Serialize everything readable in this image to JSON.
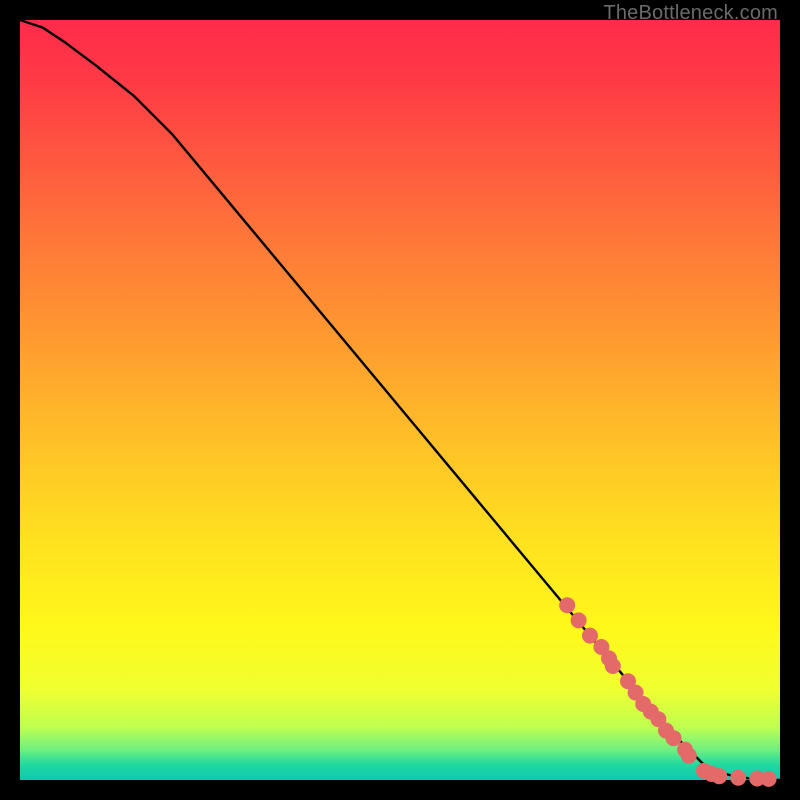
{
  "watermark": "TheBottleneck.com",
  "chart_data": {
    "type": "line",
    "title": "",
    "xlabel": "",
    "ylabel": "",
    "xlim": [
      0,
      100
    ],
    "ylim": [
      0,
      100
    ],
    "curve": {
      "name": "bottleneck-curve",
      "x": [
        0,
        3,
        6,
        10,
        15,
        20,
        30,
        40,
        50,
        60,
        70,
        80,
        85,
        88,
        90,
        92,
        94,
        96,
        98,
        100
      ],
      "y": [
        100,
        99,
        97,
        94,
        90,
        85,
        73,
        61,
        49,
        37,
        25,
        13,
        7,
        4,
        2,
        1,
        0.5,
        0.2,
        0,
        0
      ]
    },
    "highlight_points": {
      "name": "bottleneck-points",
      "color": "#e46a6a",
      "x": [
        72,
        73.5,
        75,
        76.5,
        77.5,
        78,
        80,
        81,
        82,
        83,
        84,
        85,
        86,
        87.5,
        88,
        90,
        91,
        92,
        94.5,
        97,
        98.5
      ],
      "y": [
        23,
        21,
        19,
        17.5,
        16,
        15,
        13,
        11.5,
        10,
        9,
        8,
        6.5,
        5.5,
        4,
        3.2,
        1.2,
        0.8,
        0.5,
        0.3,
        0.2,
        0.15
      ]
    }
  }
}
